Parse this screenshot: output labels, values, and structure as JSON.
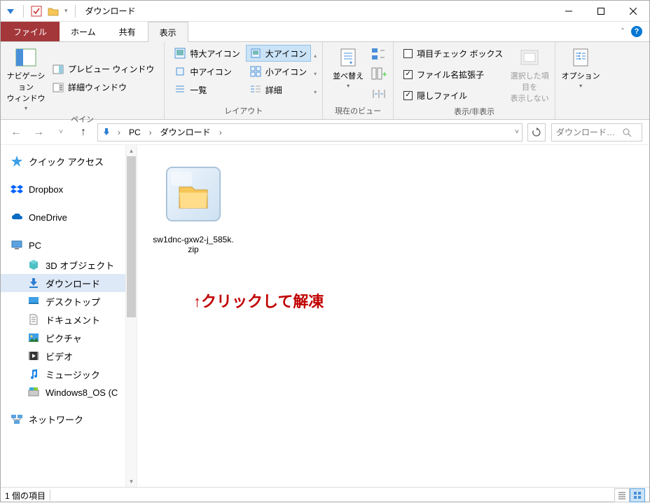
{
  "window": {
    "title": "ダウンロード"
  },
  "tabs": {
    "file": "ファイル",
    "home": "ホーム",
    "share": "共有",
    "view": "表示"
  },
  "ribbon": {
    "groups": {
      "pane": {
        "label": "ペイン",
        "navigation": "ナビゲーション\nウィンドウ",
        "preview": "プレビュー ウィンドウ",
        "details": "詳細ウィンドウ"
      },
      "layout": {
        "label": "レイアウト",
        "xl_icons": "特大アイコン",
        "l_icons": "大アイコン",
        "m_icons": "中アイコン",
        "s_icons": "小アイコン",
        "list": "一覧",
        "details": "詳細"
      },
      "current": {
        "label": "現在のビュー",
        "sort": "並べ替え"
      },
      "showhide": {
        "label": "表示/非表示",
        "checkboxes": "項目チェック ボックス",
        "extensions": "ファイル名拡張子",
        "hidden": "隠しファイル",
        "hide_selected": "選択した項目を\n表示しない"
      },
      "options": {
        "label": "オプション"
      }
    }
  },
  "breadcrumb": {
    "pc": "PC",
    "downloads": "ダウンロード"
  },
  "search": {
    "placeholder": "ダウンロード…"
  },
  "tree": {
    "quick_access": "クイック アクセス",
    "dropbox": "Dropbox",
    "onedrive": "OneDrive",
    "pc": "PC",
    "pc_children": {
      "objects3d": "3D オブジェクト",
      "downloads": "ダウンロード",
      "desktop": "デスクトップ",
      "documents": "ドキュメント",
      "pictures": "ピクチャ",
      "videos": "ビデオ",
      "music": "ミュージック",
      "os": "Windows8_OS (C"
    },
    "network": "ネットワーク"
  },
  "content": {
    "file1": {
      "name": "sw1dnc-gxw2-j_585k.zip"
    },
    "annotation": "↑クリックして解凍"
  },
  "status": {
    "item_count": "1 個の項目"
  }
}
